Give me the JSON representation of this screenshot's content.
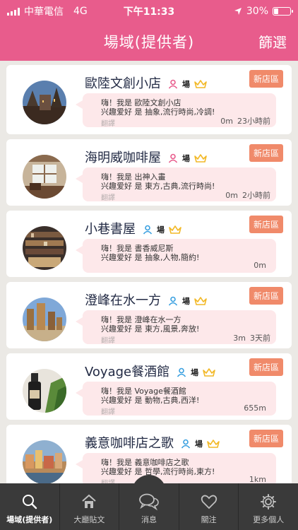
{
  "status": {
    "carrier": "中華電信",
    "network": "4G",
    "time": "下午11:33",
    "battery_text": "30%",
    "battery_level": 0.3
  },
  "nav": {
    "title": "場域(提供者)",
    "filter_label": "篩選"
  },
  "list": {
    "items": [
      {
        "name": "歐陸文創小店",
        "kind": "場",
        "badge": "新店區",
        "line1": "嗨！我是 歐陸文創小店",
        "line2": "兴趣爱好 是 抽象,流行時尚,冷調!",
        "translate": "翻譯",
        "distance": "0m",
        "time": "23小時前",
        "gender": "female"
      },
      {
        "name": "海明威咖啡屋",
        "kind": "場",
        "badge": "新店區",
        "line1": "嗨！我是 出神入畫",
        "line2": "兴趣爱好 是 東方,古典,流行時尚!",
        "translate": "翻譯",
        "distance": "0m",
        "time": "2小時前",
        "gender": "female"
      },
      {
        "name": "小巷書屋",
        "kind": "場",
        "badge": "新店區",
        "line1": "嗨！我是 書香威尼斯",
        "line2": "兴趣爱好 是 抽象,人物,簡約!",
        "translate": "",
        "distance": "0m",
        "time": "",
        "gender": "male"
      },
      {
        "name": "澄峰在水一方",
        "kind": "場",
        "badge": "新店區",
        "line1": "嗨！我是 澄峰在水一方",
        "line2": "兴趣爱好 是 東方,風景,奔放!",
        "translate": "翻譯",
        "distance": "3m",
        "time": "3天前",
        "gender": "male"
      },
      {
        "name": "Voyage餐酒館",
        "kind": "場",
        "badge": "新店區",
        "line1": "嗨！我是 Voyage餐酒館",
        "line2": "兴趣爱好 是 動物,古典,西洋!",
        "translate": "翻譯",
        "distance": "655m",
        "time": "",
        "gender": "male"
      },
      {
        "name": "義意咖啡店之歌",
        "kind": "場",
        "badge": "新店區",
        "line1": "嗨！我是 義意咖啡店之歌",
        "line2": "兴趣爱好 是 哲學,流行時尚,東方!",
        "translate": "翻譯",
        "distance": "1km",
        "time": "",
        "gender": "male"
      }
    ]
  },
  "tabs": [
    {
      "label": "場域(提供者)",
      "icon": "search-icon",
      "active": true
    },
    {
      "label": "大廳貼文",
      "icon": "home-icon",
      "active": false
    },
    {
      "label": "消息",
      "icon": "chat-bubbles-icon",
      "active": false
    },
    {
      "label": "關注",
      "icon": "heart-icon",
      "active": false
    },
    {
      "label": "更多個人",
      "icon": "gear-icon",
      "active": false
    }
  ],
  "colors": {
    "brand": "#e85c8c",
    "badge": "#f08a6a",
    "bubble": "#fde8ea",
    "tabbar": "#3a3a3a",
    "crown": "#f2b928",
    "female": "#e85c8c",
    "male": "#3aa0e0"
  }
}
